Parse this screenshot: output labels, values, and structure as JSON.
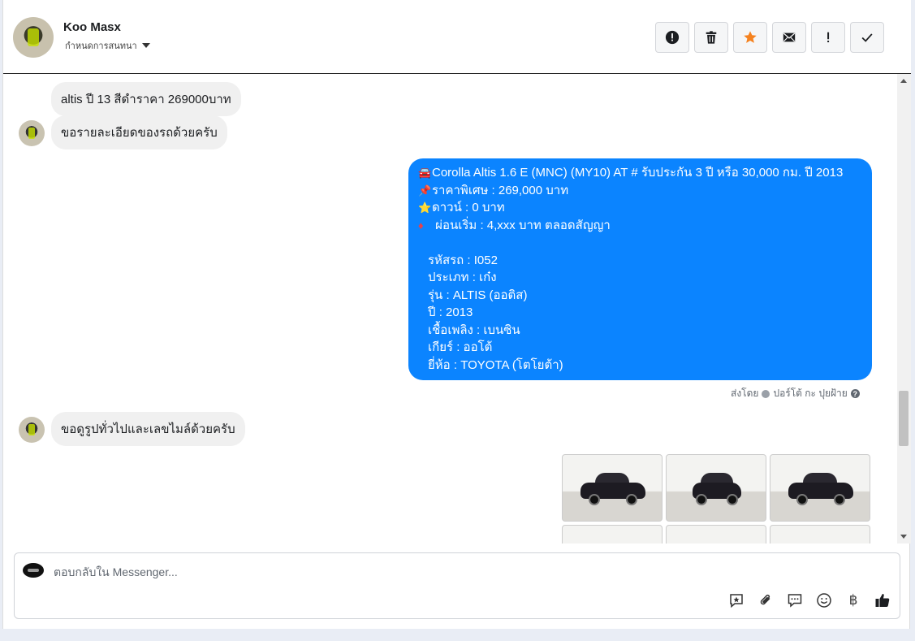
{
  "header": {
    "contact_name": "Koo Masx",
    "subtitle": "กำหนดการสนทนา",
    "actions": [
      "mark-spam-icon",
      "delete-icon",
      "star-icon",
      "email-icon",
      "flag-icon",
      "done-icon"
    ],
    "star_color": "#f5821f"
  },
  "messages": {
    "incoming_1": "altis ปี 13 สีดำราคา 269000บาท",
    "incoming_2": "ขอรายละเอียดของรถด้วยครับ",
    "outgoing": {
      "line1": "Corolla Altis 1.6 E (MNC) (MY10) AT # รับประกัน 3 ปี หรือ 30,000 กม. ปี 2013",
      "line2": "ราคาพิเศษ : 269,000 บาท",
      "line3": "ดาวน์ : 0 บาท",
      "line4": "ผ่อนเริ่ม : 4,xxx บาท ตลอดสัญญา",
      "code": "รหัสรถ : I052",
      "type": "ประเภท : เก๋ง",
      "model": "รุ่น : ALTIS (ออติส)",
      "year": "ปี : 2013",
      "fuel": "เชื้อเพลิง : เบนซิน",
      "gear": "เกียร์ : ออโต้",
      "brand": "ยี่ห้อ : TOYOTA (โตโยต้า)",
      "bubble_color": "#0b84ff"
    },
    "sent_by_label": "ส่งโดย",
    "sent_by_name": "ปอร์โต้ กะ ปุยฝ้าย",
    "incoming_3": "ขอดูรูปทั่วไปและเลขไมล์ด้วยครับ"
  },
  "composer": {
    "placeholder": "ตอบกลับใน Messenger...",
    "tools": [
      "saved-reply-icon",
      "attach-icon",
      "chat-bubble-icon",
      "emoji-icon",
      "baht-icon",
      "like-icon"
    ],
    "baht_symbol": "฿"
  }
}
